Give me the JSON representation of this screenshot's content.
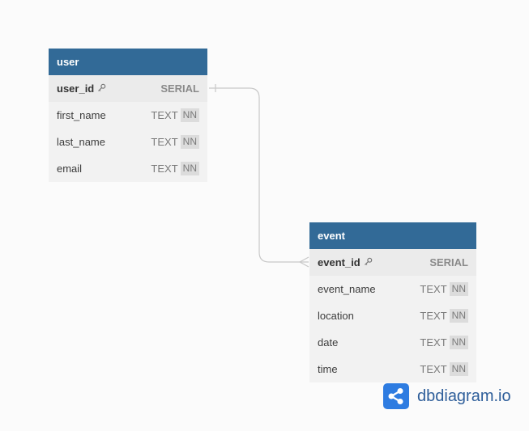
{
  "tables": [
    {
      "name": "user",
      "columns": [
        {
          "name": "user_id",
          "type": "SERIAL",
          "pk": true,
          "nn": ""
        },
        {
          "name": "first_name",
          "type": "TEXT",
          "pk": false,
          "nn": "NN"
        },
        {
          "name": "last_name",
          "type": "TEXT",
          "pk": false,
          "nn": "NN"
        },
        {
          "name": "email",
          "type": "TEXT",
          "pk": false,
          "nn": "NN"
        }
      ]
    },
    {
      "name": "event",
      "columns": [
        {
          "name": "event_id",
          "type": "SERIAL",
          "pk": true,
          "nn": ""
        },
        {
          "name": "event_name",
          "type": "TEXT",
          "pk": false,
          "nn": "NN"
        },
        {
          "name": "location",
          "type": "TEXT",
          "pk": false,
          "nn": "NN"
        },
        {
          "name": "date",
          "type": "TEXT",
          "pk": false,
          "nn": "NN"
        },
        {
          "name": "time",
          "type": "TEXT",
          "pk": false,
          "nn": "NN"
        }
      ]
    }
  ],
  "relation": {
    "from": "user.user_id",
    "to": "event.event_id",
    "from_cardinality": "one",
    "to_cardinality": "many"
  },
  "brand": {
    "name": "dbdiagram.io",
    "icon": "share-nodes-icon",
    "color": "#2e7ce1"
  },
  "colors": {
    "header": "#326a97",
    "background": "#fbfbfb",
    "table_body": "#f2f2f2"
  }
}
